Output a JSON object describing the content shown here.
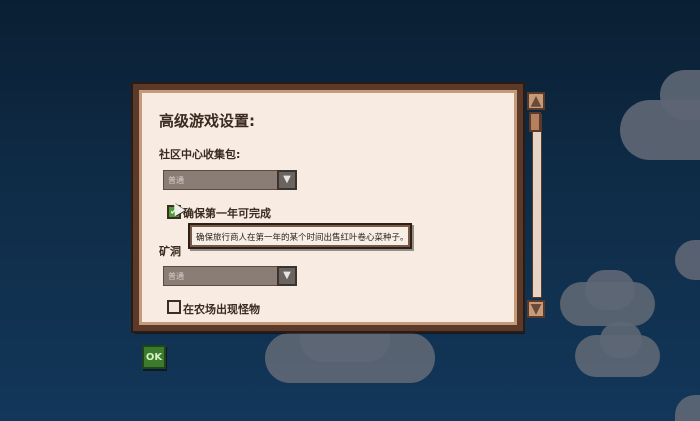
{
  "dialog": {
    "title": "高级游戏设置:",
    "community_center_label": "社区中心收集包:",
    "community_center_value": "普通",
    "guarantee_year1_label": "确保第一年可完成",
    "guarantee_year1_checked": true,
    "mines_label": "矿洞",
    "mines_value": "普通",
    "monsters_label": "在农场出现怪物",
    "monsters_checked": false
  },
  "tooltip": {
    "text": "确保旅行商人在第一年的某个时间出售红叶卷心菜种子。"
  },
  "ok_button": {
    "label": "OK"
  },
  "colors": {
    "panel_bg": "#f8ece2",
    "panel_border": "#5b3a2a",
    "check_green": "#4c9a3c",
    "sky_top": "#0a1f33"
  },
  "icons": {
    "dropdown_arrow": "▼",
    "scroll_up": "▲",
    "scroll_down": "▼",
    "checkmark": "✓"
  }
}
